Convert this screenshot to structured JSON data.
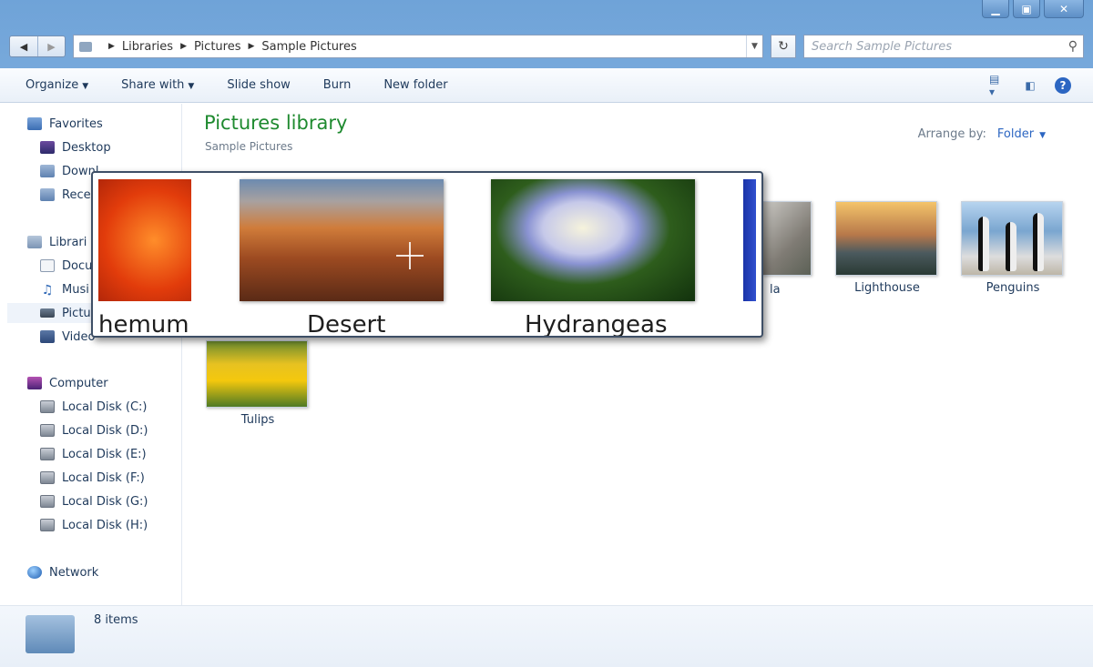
{
  "window": {
    "caption_buttons": [
      "minimize",
      "maximize",
      "close"
    ]
  },
  "address": {
    "crumbs": [
      "Libraries",
      "Pictures",
      "Sample Pictures"
    ],
    "search_placeholder": "Search Sample Pictures"
  },
  "toolbar": {
    "organize": "Organize",
    "share_with": "Share with",
    "slide_show": "Slide show",
    "burn": "Burn",
    "new_folder": "New folder"
  },
  "sidebar": {
    "favorites": "Favorites",
    "desktop": "Desktop",
    "downloads": "Downl",
    "recent": "Rece",
    "libraries": "Librari",
    "documents": "Docu",
    "music": "Musi",
    "pictures": "Pictu",
    "videos": "Video",
    "computer": "Computer",
    "disks": [
      "Local Disk (C:)",
      "Local Disk (D:)",
      "Local Disk (E:)",
      "Local Disk (F:)",
      "Local Disk (G:)",
      "Local Disk (H:)"
    ],
    "network": "Network"
  },
  "main": {
    "title": "Pictures library",
    "subtitle": "Sample Pictures",
    "arrange_label": "Arrange by:",
    "arrange_value": "Folder",
    "items": {
      "koala": "la",
      "lighthouse": "Lighthouse",
      "penguins": "Penguins",
      "tulips": "Tulips"
    }
  },
  "magnifier": {
    "chrysanthemum": "hemum",
    "desert": "Desert",
    "hydrangeas": "Hydrangeas"
  },
  "status": {
    "count": "8 items"
  }
}
